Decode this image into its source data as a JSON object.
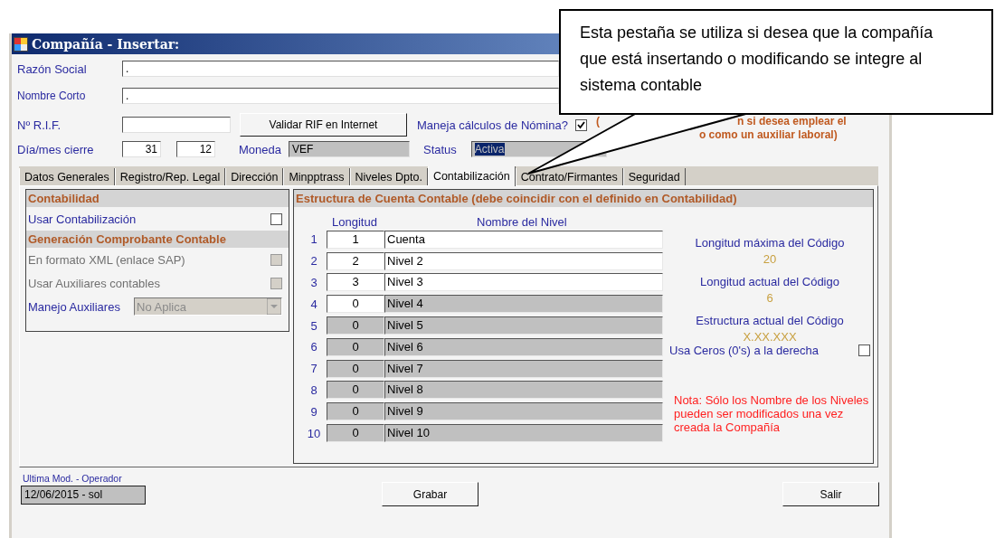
{
  "window": {
    "title": "Compañía - Insertar:"
  },
  "header": {
    "razon_social": {
      "label": "Razón Social",
      "value": "."
    },
    "nombre_corto": {
      "label": "Nombre Corto",
      "value": "."
    },
    "rif": {
      "label": "Nº R.I.F."
    },
    "validate_button": "Validar RIF en Internet",
    "nomina": {
      "label": "Maneja cálculos de Nómina?",
      "checked": true
    },
    "nomina_note": [
      "(",
      "n si desea emplear el",
      "o como un auxiliar laboral)"
    ],
    "cierre": {
      "label": "Día/mes cierre",
      "day": "31",
      "month": "12"
    },
    "moneda": {
      "label": "Moneda",
      "value": "VEF"
    },
    "status": {
      "label": "Status",
      "value": "Activa",
      "selected": true
    }
  },
  "tabs": [
    {
      "label": "Datos Generales",
      "selected": false
    },
    {
      "label": "Registro/Rep. Legal",
      "selected": false
    },
    {
      "label": "Dirección",
      "selected": false
    },
    {
      "label": "Minpptrass",
      "selected": false
    },
    {
      "label": "Niveles Dpto.",
      "selected": false
    },
    {
      "label": "Contabilización",
      "selected": true
    },
    {
      "label": "Contrato/Firmantes",
      "selected": false
    },
    {
      "label": "Seguridad",
      "selected": false
    }
  ],
  "panel": {
    "items": [
      {
        "kind": "header",
        "label": "Contabilidad"
      },
      {
        "kind": "checkbox",
        "label": "Usar Contabilización",
        "checked": false,
        "disabled": false
      },
      {
        "kind": "header",
        "label": "Generación Comprobante Contable"
      },
      {
        "kind": "checkbox",
        "label": "En formato XML (enlace SAP)",
        "checked": false,
        "disabled": true
      },
      {
        "kind": "checkbox",
        "label": "Usar Auxiliares contables",
        "checked": false,
        "disabled": true
      },
      {
        "kind": "dropdown",
        "label": "Manejo Auxiliares",
        "value": "No Aplica",
        "disabled": true
      }
    ]
  },
  "structure": {
    "title": "Estructura de Cuenta Contable (debe coincidir con el definido en Contabilidad)",
    "columns": [
      "Longitud",
      "Nombre del Nivel"
    ],
    "rows": [
      {
        "index": "1",
        "length": "1",
        "name": "Cuenta",
        "length_disabled": false,
        "name_disabled": false
      },
      {
        "index": "2",
        "length": "2",
        "name": "Nivel 2",
        "length_disabled": false,
        "name_disabled": false
      },
      {
        "index": "3",
        "length": "3",
        "name": "Nivel 3",
        "length_disabled": false,
        "name_disabled": false
      },
      {
        "index": "4",
        "length": "0",
        "name": "Nivel 4",
        "length_disabled": false,
        "name_disabled": true
      },
      {
        "index": "5",
        "length": "0",
        "name": "Nivel 5",
        "length_disabled": true,
        "name_disabled": true
      },
      {
        "index": "6",
        "length": "0",
        "name": "Nivel 6",
        "length_disabled": true,
        "name_disabled": true
      },
      {
        "index": "7",
        "length": "0",
        "name": "Nivel 7",
        "length_disabled": true,
        "name_disabled": true
      },
      {
        "index": "8",
        "length": "0",
        "name": "Nivel 8",
        "length_disabled": true,
        "name_disabled": true
      },
      {
        "index": "9",
        "length": "0",
        "name": "Nivel 9",
        "length_disabled": true,
        "name_disabled": true
      },
      {
        "index": "10",
        "length": "0",
        "name": "Nivel 10",
        "length_disabled": true,
        "name_disabled": true
      }
    ],
    "info": [
      {
        "label": "Longitud máxima del Código",
        "value": "20"
      },
      {
        "label": "Longitud actual del Código",
        "value": "6"
      },
      {
        "label": "Estructura actual del Código",
        "value": "X.XX.XXX"
      }
    ],
    "zeros": {
      "label": "Usa Ceros (0's) a la derecha",
      "checked": false
    },
    "note": "Nota: Sólo los Nombre de los Niveles pueden ser modificados una vez creada la Compañía"
  },
  "footer": {
    "last_mod": {
      "label": "Ultima Mod. - Operador",
      "value": "12/06/2015 - sol"
    },
    "buttons": [
      "Grabar",
      "Salir"
    ]
  },
  "callout": {
    "text": "Esta pestaña se utiliza si desea que la compañía que está insertando o modificando se integre al sistema contable"
  }
}
